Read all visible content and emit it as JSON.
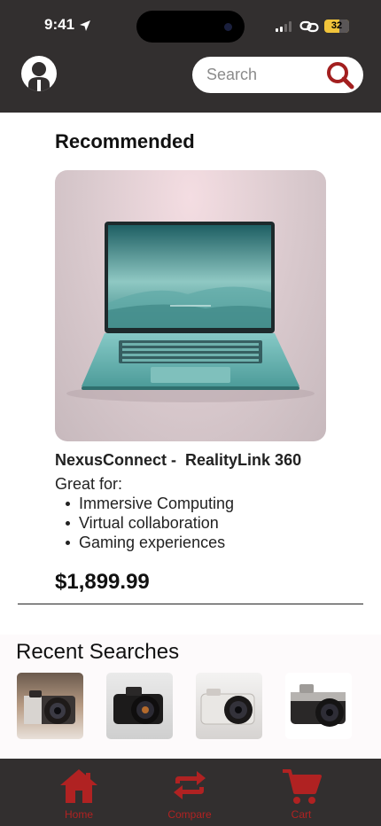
{
  "status_bar": {
    "time": "9:41",
    "battery": "32"
  },
  "header": {
    "search_placeholder": "Search"
  },
  "recommended": {
    "title": "Recommended",
    "product_name": "NexusConnect -  RealityLink 360",
    "great_for_label": "Great for:",
    "features": [
      "Immersive Computing",
      "Virtual collaboration",
      "Gaming experiences"
    ],
    "price": "$1,899.99"
  },
  "recent_searches": {
    "title": "Recent Searches"
  },
  "tabs": [
    {
      "label": "Home",
      "icon": "home-icon"
    },
    {
      "label": "Compare",
      "icon": "compare-icon"
    },
    {
      "label": "Cart",
      "icon": "cart-icon"
    }
  ],
  "colors": {
    "header_bg": "#322f2f",
    "accent_red": "#b02222",
    "battery_yellow": "#f1c43b"
  }
}
